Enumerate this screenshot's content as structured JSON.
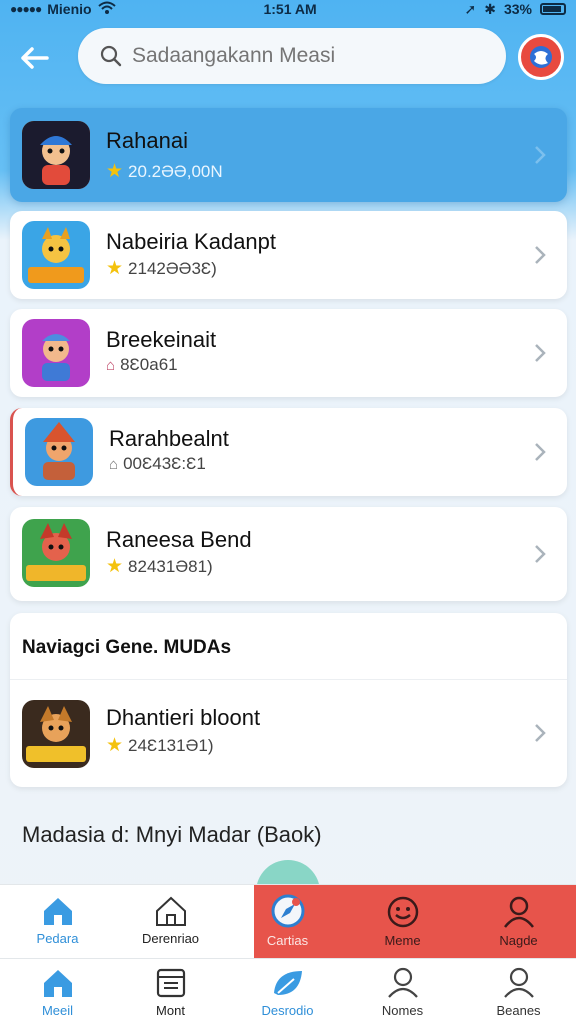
{
  "status": {
    "carrier": "Mienio",
    "time": "1:51 AM",
    "battery": "33%"
  },
  "search": {
    "placeholder": "Sadaangakann Measi",
    "value": ""
  },
  "colors": {
    "header_blue": "#4fb3f2",
    "highlight_blue": "#4aa7e6",
    "accent_red": "#e7544b",
    "star": "#f4c20d",
    "tab_active": "#2f8fd8"
  },
  "apps": [
    {
      "name": "Rahanai",
      "meta_icon": "star-icon",
      "meta": "20.2ƏƏ,00N",
      "selected": true
    },
    {
      "name": "Nabeiria Kadanpt",
      "meta_icon": "star-icon",
      "meta": "2142ƏƏ3Ɛ)",
      "selected": false
    },
    {
      "name": "Breekeinait",
      "meta_icon": "home-icon",
      "meta": "8Ɛ0a61",
      "selected": false
    },
    {
      "name": "Rarahbealnt",
      "meta_icon": "home-icon",
      "meta": "00Ɛ43Ɛ:Ɛ1",
      "selected": false
    },
    {
      "name": "Raneesa Bend",
      "meta_icon": "star-icon",
      "meta": "82431Ə81)",
      "selected": false
    }
  ],
  "section": {
    "title": "Naviagci Gene. MUDAs",
    "item": {
      "name": "Dhantieri bloont",
      "meta_icon": "star-icon",
      "meta": "24Ɛ131Ə1)"
    }
  },
  "footer_text": "Madasia d: Mnyi Madar (Baok)",
  "tabbar_top": [
    {
      "label": "Pedara",
      "icon": "home-icon",
      "active": true
    },
    {
      "label": "Derenriao",
      "icon": "house-outline-icon",
      "active": false
    },
    {
      "label": "Cartias",
      "icon": "compass-icon",
      "active": true
    },
    {
      "label": "Meme",
      "icon": "smile-icon",
      "active": false
    },
    {
      "label": "Nagde",
      "icon": "user-icon",
      "active": false
    }
  ],
  "tabbar_bottom": [
    {
      "label": "Meeil",
      "icon": "home-icon",
      "active": true
    },
    {
      "label": "Mont",
      "icon": "window-icon",
      "active": false
    },
    {
      "label": "Desrodio",
      "icon": "leaf-icon",
      "active": true
    },
    {
      "label": "Nomes",
      "icon": "user-icon",
      "active": false
    },
    {
      "label": "Beanes",
      "icon": "user-icon",
      "active": false
    }
  ]
}
